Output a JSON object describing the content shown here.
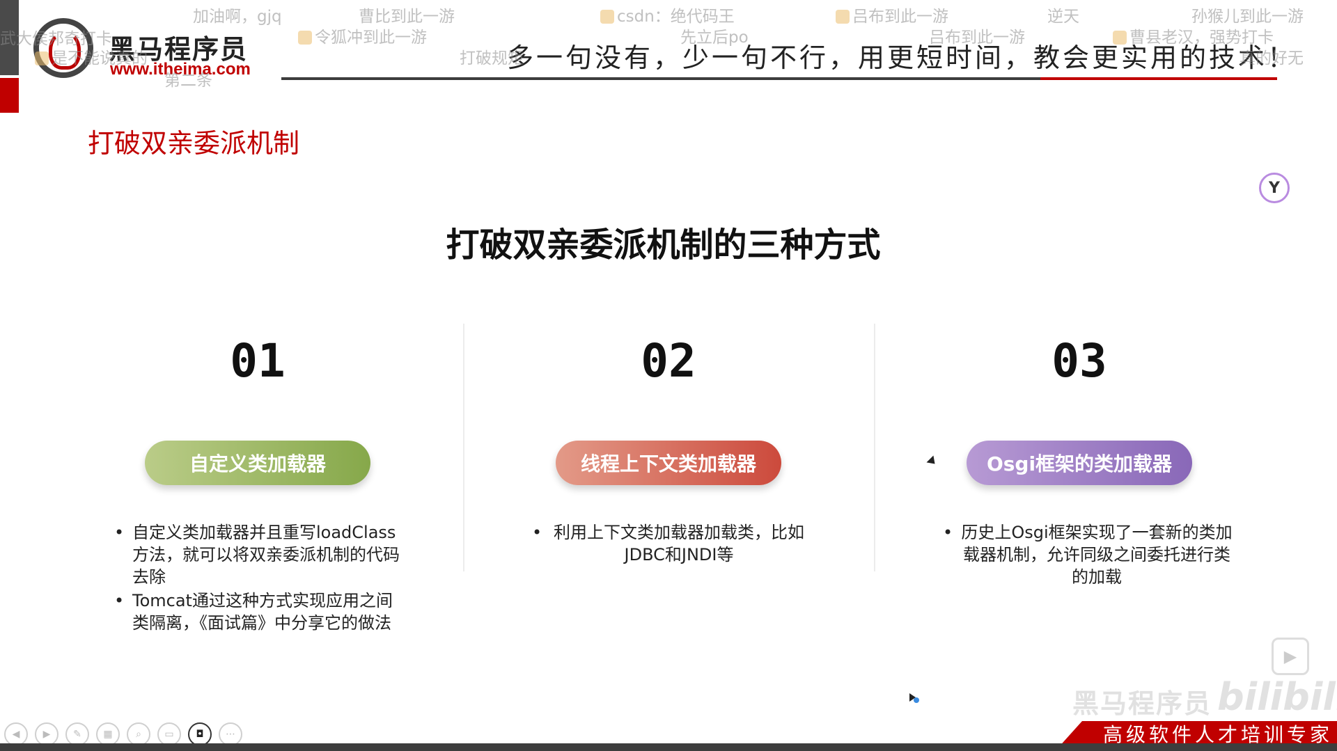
{
  "header": {
    "logo_name": "黑马程序员",
    "logo_url": "www.itheima.com",
    "slogan": "多一句没有，少一句不行，用更短时间，教会更实用的技术！"
  },
  "danmaku": [
    "武大侯邦奇打卡",
    "加油啊，gjq",
    "曹比到此一游",
    "csdn：绝代码王",
    "吕布到此一游",
    "逆天",
    "孙猴儿到此一游",
    "是不能说真的",
    "令狐冲到此一游",
    "先立后po",
    "吕布到此一游",
    "曹县老汉，强势打卡",
    "打破规矩",
    "真的好无",
    "第二条"
  ],
  "slide": {
    "section_title": "打破双亲委派机制",
    "main_title": "打破双亲委派机制的三种方式",
    "columns": [
      {
        "number": "01",
        "pill": "自定义类加载器",
        "bullets": [
          "自定义类加载器并且重写loadClass方法，就可以将双亲委派机制的代码去除",
          "Tomcat通过这种方式实现应用之间类隔离，《面试篇》中分享它的做法"
        ]
      },
      {
        "number": "02",
        "pill": "线程上下文类加载器",
        "bullets": [
          "利用上下文类加载器加载类，比如JDBC和JNDI等"
        ]
      },
      {
        "number": "03",
        "pill": "Osgi框架的类加载器",
        "bullets": [
          "历史上Osgi框架实现了一套新的类加载器机制，允许同级之间委托进行类的加载"
        ]
      }
    ]
  },
  "footer": {
    "banner_text": "高级软件人才培训专家",
    "watermark": "黑马程序员",
    "bili": "bilibili"
  },
  "icons": {
    "controls": [
      "prev-icon",
      "next-icon",
      "pen-icon",
      "slides-icon",
      "zoom-icon",
      "subtitle-icon",
      "camera-icon",
      "more-icon"
    ]
  }
}
